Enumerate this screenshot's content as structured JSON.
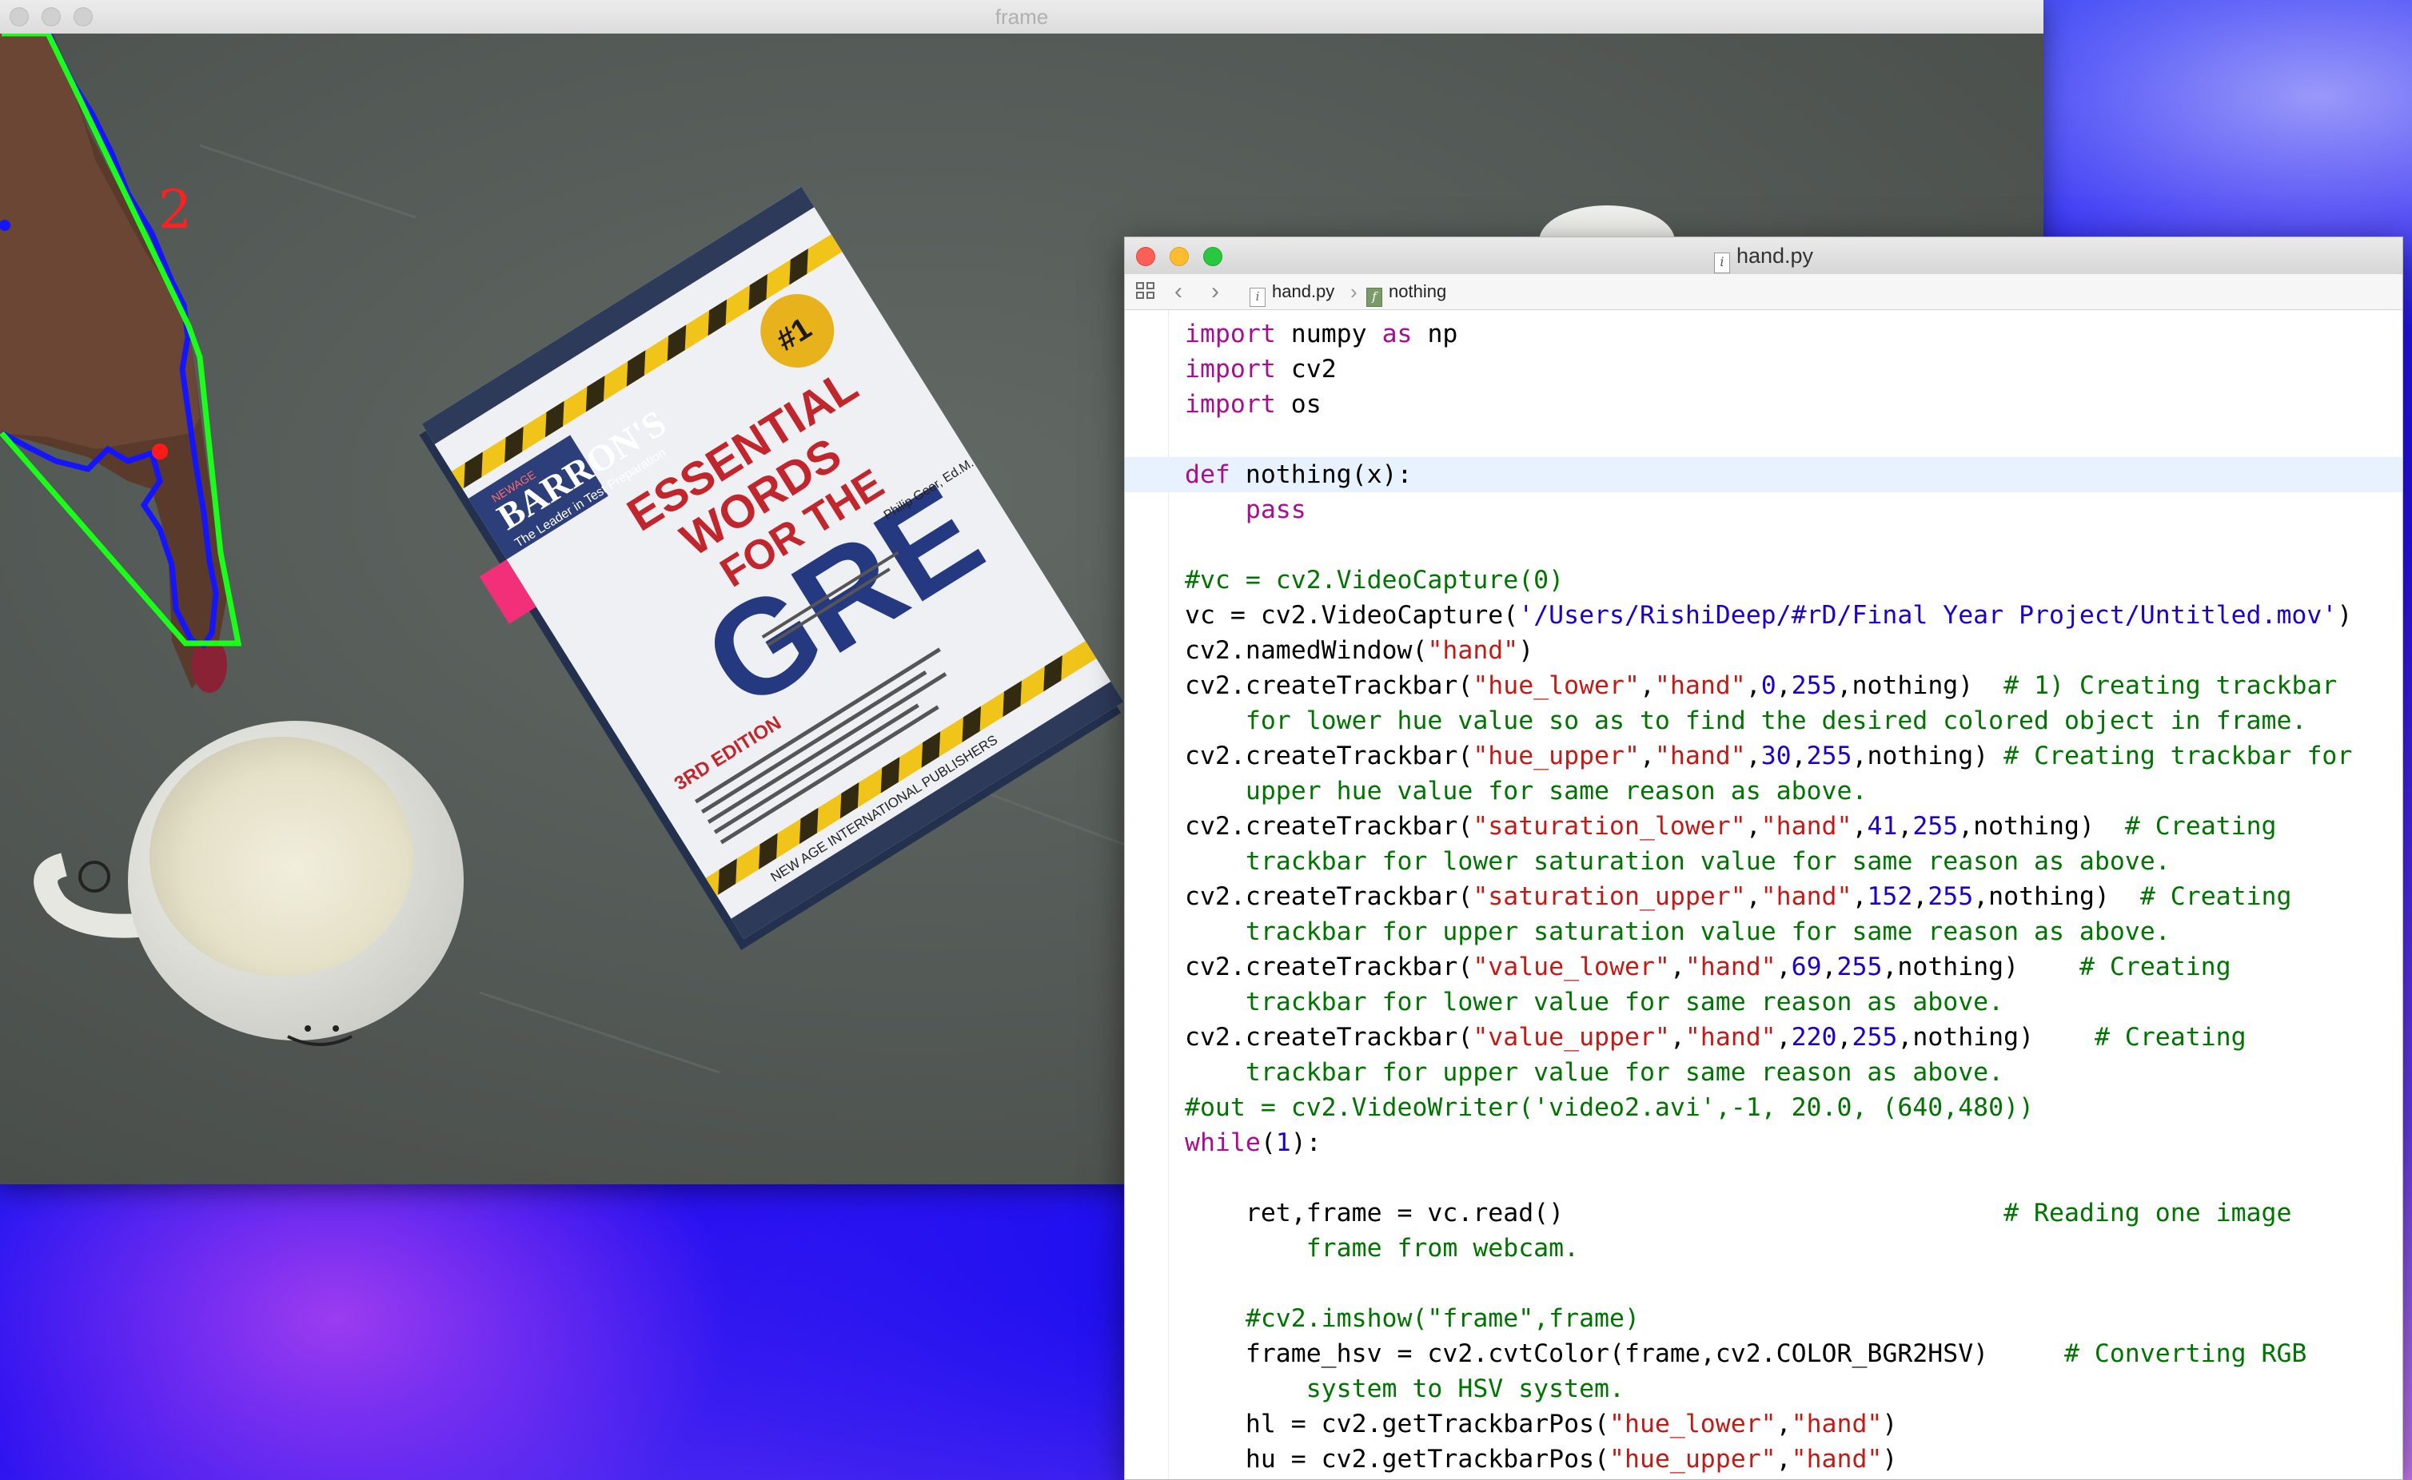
{
  "frame_window": {
    "title": "frame",
    "overlay_label": "2",
    "contour_color": "#19ff19",
    "hull_color": "#1414ff",
    "fingertip_color": "#ff1a1a",
    "book": {
      "brand": "BARRON'S",
      "tagline": "The Leader in Test Preparation",
      "publisher_top": "NEWAGE",
      "title_line1": "ESSENTIAL",
      "title_line2": "WORDS",
      "title_line3": "FOR THE",
      "title_line4": "GRE",
      "edition": "3RD EDITION",
      "author": "Philip Geer, Ed.M.",
      "badge": "#1",
      "publisher_bottom": "NEW AGE INTERNATIONAL PUBLISHERS"
    }
  },
  "editor": {
    "title": "hand.py",
    "breadcrumb": {
      "file": "hand.py",
      "symbol": "nothing"
    },
    "code_lines": [
      [
        [
          "kw",
          "import"
        ],
        [
          "pl",
          " numpy "
        ],
        [
          "kw",
          "as"
        ],
        [
          "pl",
          " np"
        ]
      ],
      [
        [
          "kw",
          "import"
        ],
        [
          "pl",
          " cv2"
        ]
      ],
      [
        [
          "kw",
          "import"
        ],
        [
          "pl",
          " os"
        ]
      ],
      [],
      [
        [
          "kw",
          "def"
        ],
        [
          "pl",
          " nothing(x):"
        ]
      ],
      [
        [
          "pl",
          "    "
        ],
        [
          "kw",
          "pass"
        ]
      ],
      [],
      [
        [
          "cm",
          "#vc = cv2.VideoCapture(0)"
        ]
      ],
      [
        [
          "pl",
          "vc = cv2.VideoCapture("
        ],
        [
          "pa",
          "'/Users/RishiDeep/#rD/Final Year Project/Untitled.mov'"
        ],
        [
          "pl",
          ")"
        ]
      ],
      [
        [
          "pl",
          "cv2.namedWindow("
        ],
        [
          "st",
          "\"hand\""
        ],
        [
          "pl",
          ")"
        ]
      ],
      [
        [
          "pl",
          "cv2.createTrackbar("
        ],
        [
          "st",
          "\"hue_lower\""
        ],
        [
          "pl",
          ","
        ],
        [
          "st",
          "\"hand\""
        ],
        [
          "pl",
          ","
        ],
        [
          "nm",
          "0"
        ],
        [
          "pl",
          ","
        ],
        [
          "nm",
          "255"
        ],
        [
          "pl",
          ",nothing)  "
        ],
        [
          "cm",
          "# 1) Creating trackbar"
        ]
      ],
      [
        [
          "cm",
          "    for lower hue value so as to find the desired colored object in frame."
        ]
      ],
      [
        [
          "pl",
          "cv2.createTrackbar("
        ],
        [
          "st",
          "\"hue_upper\""
        ],
        [
          "pl",
          ","
        ],
        [
          "st",
          "\"hand\""
        ],
        [
          "pl",
          ","
        ],
        [
          "nm",
          "30"
        ],
        [
          "pl",
          ","
        ],
        [
          "nm",
          "255"
        ],
        [
          "pl",
          ",nothing) "
        ],
        [
          "cm",
          "# Creating trackbar for"
        ]
      ],
      [
        [
          "cm",
          "    upper hue value for same reason as above."
        ]
      ],
      [
        [
          "pl",
          "cv2.createTrackbar("
        ],
        [
          "st",
          "\"saturation_lower\""
        ],
        [
          "pl",
          ","
        ],
        [
          "st",
          "\"hand\""
        ],
        [
          "pl",
          ","
        ],
        [
          "nm",
          "41"
        ],
        [
          "pl",
          ","
        ],
        [
          "nm",
          "255"
        ],
        [
          "pl",
          ",nothing)  "
        ],
        [
          "cm",
          "# Creating"
        ]
      ],
      [
        [
          "cm",
          "    trackbar for lower saturation value for same reason as above."
        ]
      ],
      [
        [
          "pl",
          "cv2.createTrackbar("
        ],
        [
          "st",
          "\"saturation_upper\""
        ],
        [
          "pl",
          ","
        ],
        [
          "st",
          "\"hand\""
        ],
        [
          "pl",
          ","
        ],
        [
          "nm",
          "152"
        ],
        [
          "pl",
          ","
        ],
        [
          "nm",
          "255"
        ],
        [
          "pl",
          ",nothing)  "
        ],
        [
          "cm",
          "# Creating"
        ]
      ],
      [
        [
          "cm",
          "    trackbar for upper saturation value for same reason as above."
        ]
      ],
      [
        [
          "pl",
          "cv2.createTrackbar("
        ],
        [
          "st",
          "\"value_lower\""
        ],
        [
          "pl",
          ","
        ],
        [
          "st",
          "\"hand\""
        ],
        [
          "pl",
          ","
        ],
        [
          "nm",
          "69"
        ],
        [
          "pl",
          ","
        ],
        [
          "nm",
          "255"
        ],
        [
          "pl",
          ",nothing)    "
        ],
        [
          "cm",
          "# Creating"
        ]
      ],
      [
        [
          "cm",
          "    trackbar for lower value for same reason as above."
        ]
      ],
      [
        [
          "pl",
          "cv2.createTrackbar("
        ],
        [
          "st",
          "\"value_upper\""
        ],
        [
          "pl",
          ","
        ],
        [
          "st",
          "\"hand\""
        ],
        [
          "pl",
          ","
        ],
        [
          "nm",
          "220"
        ],
        [
          "pl",
          ","
        ],
        [
          "nm",
          "255"
        ],
        [
          "pl",
          ",nothing)    "
        ],
        [
          "cm",
          "# Creating"
        ]
      ],
      [
        [
          "cm",
          "    trackbar for upper value for same reason as above."
        ]
      ],
      [
        [
          "cm",
          "#out = cv2.VideoWriter('video2.avi',-1, 20.0, (640,480))"
        ]
      ],
      [
        [
          "kw",
          "while"
        ],
        [
          "pl",
          "("
        ],
        [
          "nm",
          "1"
        ],
        [
          "pl",
          "):"
        ]
      ],
      [],
      [
        [
          "pl",
          "    ret,frame = vc.read()                             "
        ],
        [
          "cm",
          "# Reading one image"
        ]
      ],
      [
        [
          "cm",
          "        frame from webcam."
        ]
      ],
      [],
      [
        [
          "cm",
          "    #cv2.imshow(\"frame\",frame)"
        ]
      ],
      [
        [
          "pl",
          "    frame_hsv = cv2.cvtColor(frame,cv2.COLOR_BGR2HSV)     "
        ],
        [
          "cm",
          "# Converting RGB"
        ]
      ],
      [
        [
          "cm",
          "        system to HSV system."
        ]
      ],
      [
        [
          "pl",
          "    hl = cv2.getTrackbarPos("
        ],
        [
          "st",
          "\"hue_lower\""
        ],
        [
          "pl",
          ","
        ],
        [
          "st",
          "\"hand\""
        ],
        [
          "pl",
          ")"
        ]
      ],
      [
        [
          "pl",
          "    hu = cv2.getTrackbarPos("
        ],
        [
          "st",
          "\"hue_upper\""
        ],
        [
          "pl",
          ","
        ],
        [
          "st",
          "\"hand\""
        ],
        [
          "pl",
          ")"
        ]
      ]
    ],
    "highlighted_line": 4
  }
}
